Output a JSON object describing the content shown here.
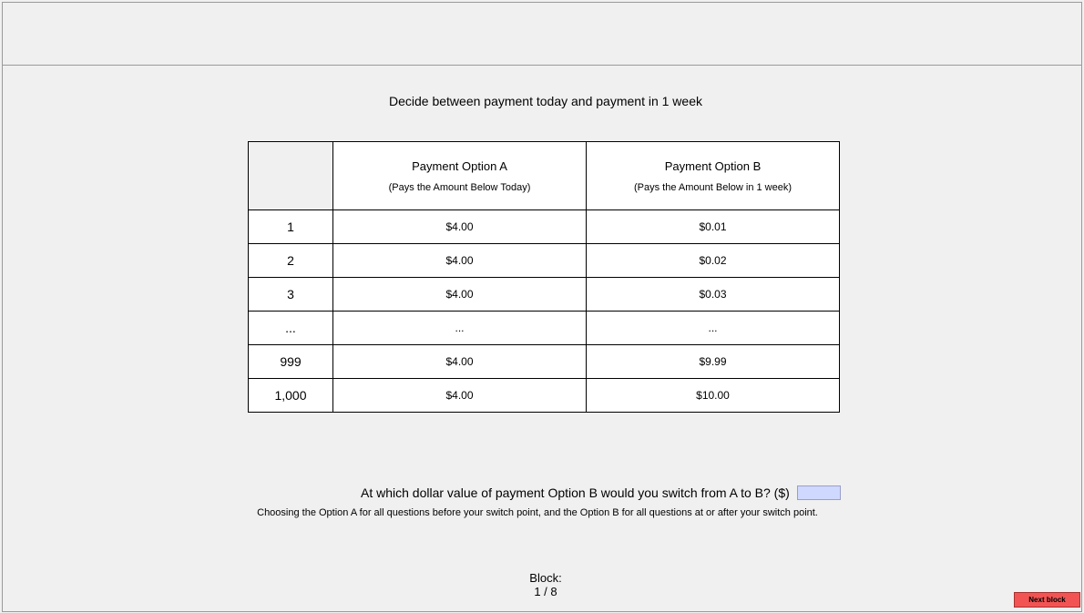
{
  "title": "Decide between payment today and payment in 1 week",
  "table": {
    "option_a_header": "Payment Option A",
    "option_a_sub": "(Pays the Amount Below Today)",
    "option_b_header": "Payment Option B",
    "option_b_sub": "(Pays the Amount Below in 1 week)",
    "rows": [
      {
        "num": "1",
        "a": "$4.00",
        "b": "$0.01"
      },
      {
        "num": "2",
        "a": "$4.00",
        "b": "$0.02"
      },
      {
        "num": "3",
        "a": "$4.00",
        "b": "$0.03"
      },
      {
        "num": "...",
        "a": "...",
        "b": "..."
      },
      {
        "num": "999",
        "a": "$4.00",
        "b": "$9.99"
      },
      {
        "num": "1,000",
        "a": "$4.00",
        "b": "$10.00"
      }
    ]
  },
  "question": {
    "text": "At which dollar value of payment Option B would you switch from A to B? ($)",
    "input_value": ""
  },
  "instruction": "Choosing the Option A for all questions before your switch point, and the Option B for all questions at or after your switch point.",
  "block": {
    "label": "Block:",
    "progress": "1 / 8"
  },
  "next_button": "Next block",
  "colors": {
    "background": "#f0f0f0",
    "input": "#cfd8ff",
    "next_button": "#f25454"
  }
}
